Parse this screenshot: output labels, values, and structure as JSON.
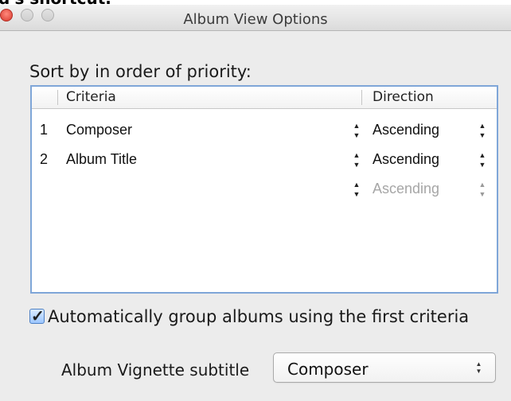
{
  "window": {
    "title": "Album View Options"
  },
  "cropped_top_text": "d's shortcut.",
  "sort": {
    "label": "Sort by in order of priority:",
    "columns": {
      "criteria": "Criteria",
      "direction": "Direction"
    },
    "rows": [
      {
        "number": "1",
        "criteria": "Composer",
        "direction": "Ascending"
      },
      {
        "number": "2",
        "criteria": "Album Title",
        "direction": "Ascending"
      },
      {
        "number": "",
        "criteria": "",
        "direction": "Ascending"
      }
    ]
  },
  "auto_group": {
    "label": "Automatically group albums using the first criteria",
    "checked": true
  },
  "vignette": {
    "label": "Album Vignette subtitle",
    "selected": "Composer"
  },
  "colors": {
    "table_border": "#7fa6d8",
    "checkbox": "#9cc6ff"
  },
  "icons": {
    "stepper": "up-down-arrows-icon",
    "check": "checkmark-icon"
  }
}
